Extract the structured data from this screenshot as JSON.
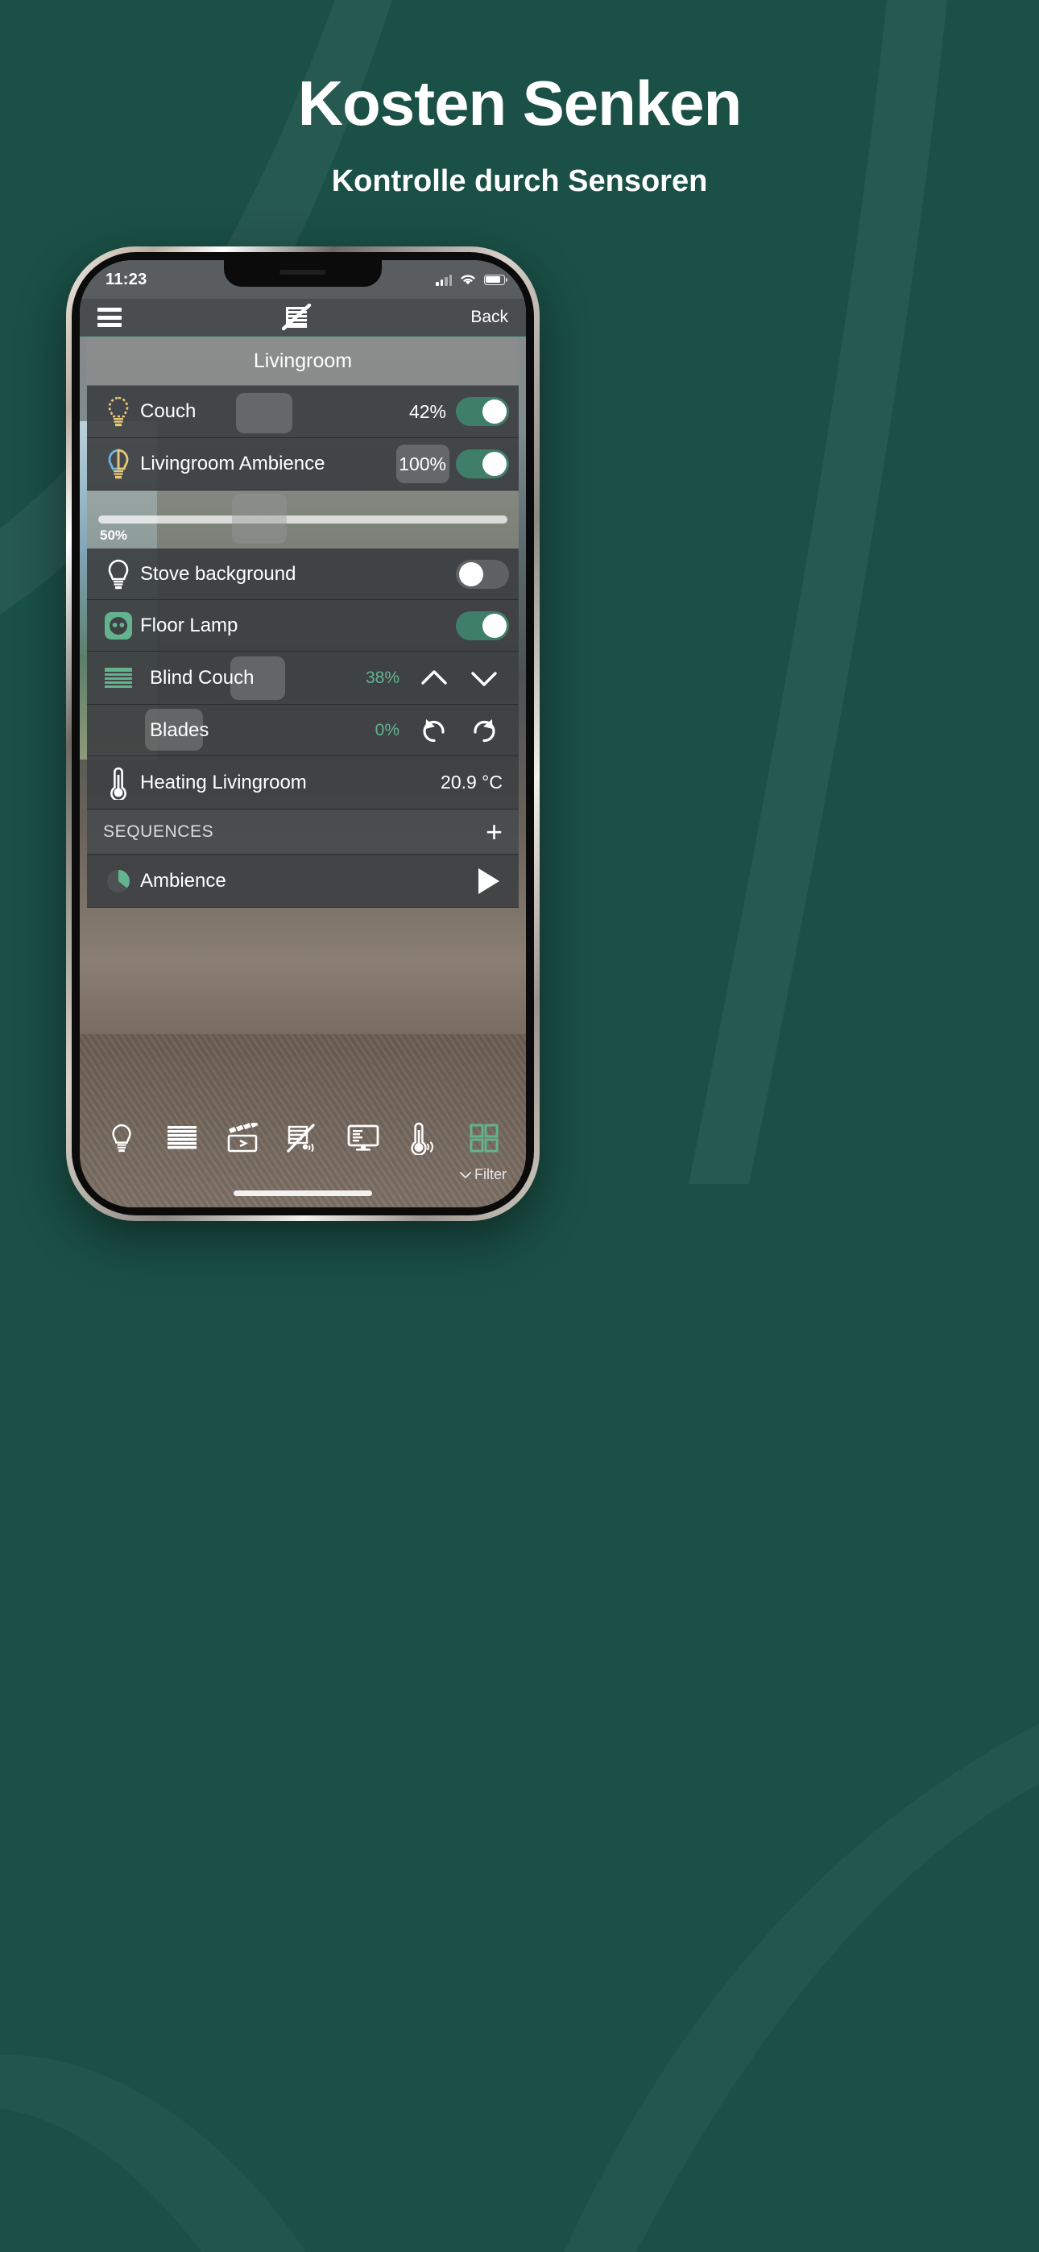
{
  "promo": {
    "title": "Kosten Senken",
    "subtitle": "Kontrolle durch Sensoren",
    "background_color": "#1a5046",
    "text_color": "#ffffff"
  },
  "phone": {
    "statusbar": {
      "time": "11:23",
      "signal_icon": "signal-bars-icon",
      "wifi_icon": "wifi-icon",
      "battery_icon": "battery-icon"
    },
    "navbar": {
      "menu_icon": "hamburger-menu-icon",
      "logo_icon": "blinds-slash-logo-icon",
      "back_label": "Back"
    }
  },
  "app": {
    "room_title": "Livingroom",
    "accent_green": "#63b38e",
    "toggle_on_color": "#3f7f69",
    "rows": [
      {
        "name": "Couch",
        "icon": "lightbulb-dashed-icon",
        "icon_color": "#e8c97a",
        "value": "42%",
        "toggle": "on"
      },
      {
        "name": "Livingroom Ambience",
        "icon": "lightbulb-color-icon",
        "icon_color": "#6fb6e0",
        "value": "100%",
        "toggle": "on"
      },
      {
        "name": "Stove background",
        "icon": "lightbulb-outline-icon",
        "icon_color": "#ffffff",
        "value": "",
        "toggle": "off"
      },
      {
        "name": "Floor Lamp",
        "icon": "power-socket-icon",
        "icon_color": "#63b38e",
        "value": "",
        "toggle": "on"
      }
    ],
    "slider": {
      "value_label": "50%",
      "fill_percent": 50
    },
    "blind": {
      "name": "Blind Couch",
      "icon": "blinds-icon",
      "icon_color": "#63b38e",
      "value": "38%",
      "up_icon": "chevron-up-icon",
      "down_icon": "chevron-down-icon",
      "blades_name": "Blades",
      "blades_value": "0%",
      "rotate_left_icon": "rotate-left-icon",
      "rotate_right_icon": "rotate-right-icon"
    },
    "heating": {
      "name": "Heating Livingroom",
      "icon": "thermometer-icon",
      "value": "20.9 °C"
    },
    "sequences": {
      "header": "SEQUENCES",
      "add_icon": "plus-icon",
      "item_name": "Ambience",
      "item_icon": "pie-chart-icon",
      "play_icon": "play-icon"
    },
    "toolbar": [
      {
        "icon": "lightbulb-icon",
        "name": "lights"
      },
      {
        "icon": "blinds-icon",
        "name": "blinds"
      },
      {
        "icon": "clapperboard-icon",
        "name": "scenes"
      },
      {
        "icon": "blind-sensor-slash-icon",
        "name": "sensors"
      },
      {
        "icon": "display-icon",
        "name": "display"
      },
      {
        "icon": "thermometer-sensor-icon",
        "name": "climate"
      },
      {
        "icon": "grid-icon",
        "name": "overview"
      }
    ],
    "filter_label": "Filter",
    "filter_icon": "chevron-down-icon"
  }
}
